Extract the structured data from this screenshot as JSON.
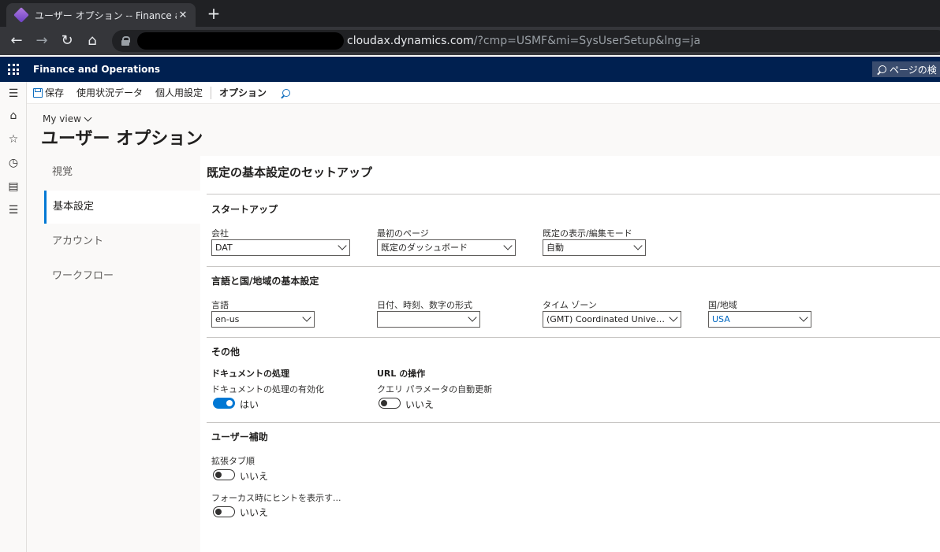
{
  "browser": {
    "tab_title": "ユーザー オプション -- Finance and O",
    "tab_close": "✕",
    "new_tab": "+",
    "url_host": "cloudax.dynamics.com",
    "url_rest": "/?cmp=USMF&mi=SysUserSetup&lng=ja"
  },
  "app": {
    "name": "Finance and Operations",
    "page_search": "ページの検"
  },
  "actions": {
    "save": "保存",
    "usage_data": "使用状況データ",
    "personalize": "個人用設定",
    "options": "オプション"
  },
  "header": {
    "my_view": "My view",
    "title": "ユーザー オプション"
  },
  "vtabs": [
    {
      "label": "視覚",
      "active": false
    },
    {
      "label": "基本設定",
      "active": true
    },
    {
      "label": "アカウント",
      "active": false
    },
    {
      "label": "ワークフロー",
      "active": false
    }
  ],
  "content": {
    "title": "既定の基本設定のセットアップ",
    "startup": {
      "title": "スタートアップ",
      "company_label": "会社",
      "company_value": "DAT",
      "first_page_label": "最初のページ",
      "first_page_value": "既定のダッシュボード",
      "mode_label": "既定の表示/編集モード",
      "mode_value": "自動"
    },
    "locale": {
      "title": "言語と国/地域の基本設定",
      "language_label": "言語",
      "language_value": "en-us",
      "format_label": "日付、時刻、数字の形式",
      "format_value": "",
      "timezone_label": "タイム ゾーン",
      "timezone_value": "(GMT) Coordinated Universal Time",
      "country_label": "国/地域",
      "country_value": "USA"
    },
    "other": {
      "title": "その他",
      "doc_group": "ドキュメントの処理",
      "doc_enable_label": "ドキュメントの処理の有効化",
      "doc_enable_value": "はい",
      "url_group": "URL の操作",
      "url_auto_label": "クエリ パラメータの自動更新",
      "url_auto_value": "いいえ"
    },
    "accessibility": {
      "title": "ユーザー補助",
      "tab_order_label": "拡張タブ順",
      "tab_order_value": "いいえ",
      "hint_label": "フォーカス時にヒントを表示す...",
      "hint_value": "いいえ"
    }
  },
  "colors": {
    "app_header": "#002050",
    "accent": "#0078d4"
  }
}
